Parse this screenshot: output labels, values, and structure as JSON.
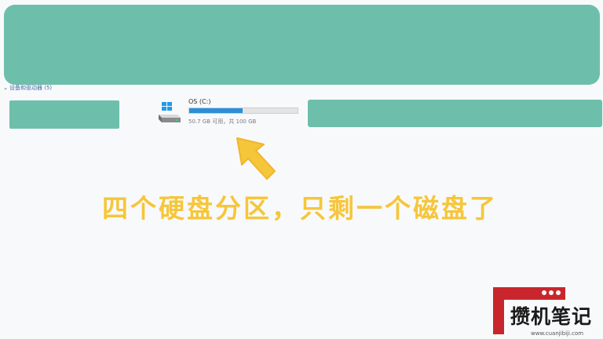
{
  "section": {
    "chevron": "⌄",
    "label": "设备和驱动器 (5)"
  },
  "drive": {
    "name": "OS (C:)",
    "usage_fraction": 0.49,
    "free_text": "50.7 GB 可用，共 100 GB",
    "icon": "hard-drive-icon"
  },
  "annotation": {
    "caption": "四个硬盘分区，只剩一个磁盘了",
    "arrow_icon": "arrow-up-left-icon"
  },
  "watermark": {
    "title": "攒机笔记",
    "url": "www.cuanjibiji.com"
  },
  "colors": {
    "redaction": "#6dbfab",
    "bar_fill": "#2b8fd8",
    "caption": "#f6c63a",
    "watermark_red": "#c8262c"
  }
}
